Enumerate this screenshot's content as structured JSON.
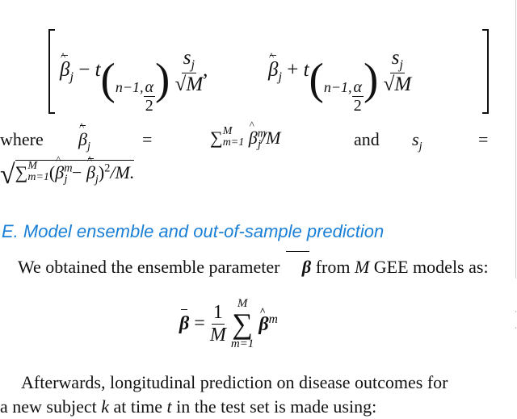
{
  "equation_ci": {
    "left_term": "β̄̂_j − t_(n−1, α/2) s_j/√M",
    "right_term": "β̄̂_j + t_(n−1, α/2) s_j/√M",
    "beta": "β",
    "sub_j": "j",
    "minus": "−",
    "plus": "+",
    "t": "t",
    "sub_df": "n−1,",
    "alpha": "α",
    "two": "2",
    "s": "s",
    "M": "M",
    "comma": ","
  },
  "where_line": {
    "word_where": "where",
    "equals": "=",
    "sum_expr": "∑",
    "sum_upper": "M",
    "sum_lower": "m=1",
    "beta_hat_m": "β",
    "sup_m": "m",
    "sub_j": "j",
    "over_M": "/M",
    "word_and": "and",
    "s_j": "s",
    "sqrt_body_open": "(",
    "sqrt_body_minus": " − ",
    "sqrt_body_close": ")",
    "squared": "2",
    "end": "/M."
  },
  "section_heading": "E.  Model ensemble and out-of-sample prediction",
  "paragraph1": {
    "text_before": "We obtained the ensemble parameter",
    "beta_symbol": "β",
    "text_mid": "from",
    "M": "M",
    "text_after": "GEE models as:"
  },
  "equation_ensemble": {
    "lhs": "β",
    "equals": "=",
    "num": "1",
    "den": "M",
    "sigma": "∑",
    "upper": "M",
    "lower": "m=1",
    "rhs": "β",
    "sup": "m"
  },
  "paragraph2": {
    "line1": "Afterwards, longitudinal prediction on disease outcomes for",
    "line2_a": "a new subject",
    "k": "k",
    "line2_b": "at time",
    "t": "t",
    "line2_c": "in the test set is made using:"
  }
}
